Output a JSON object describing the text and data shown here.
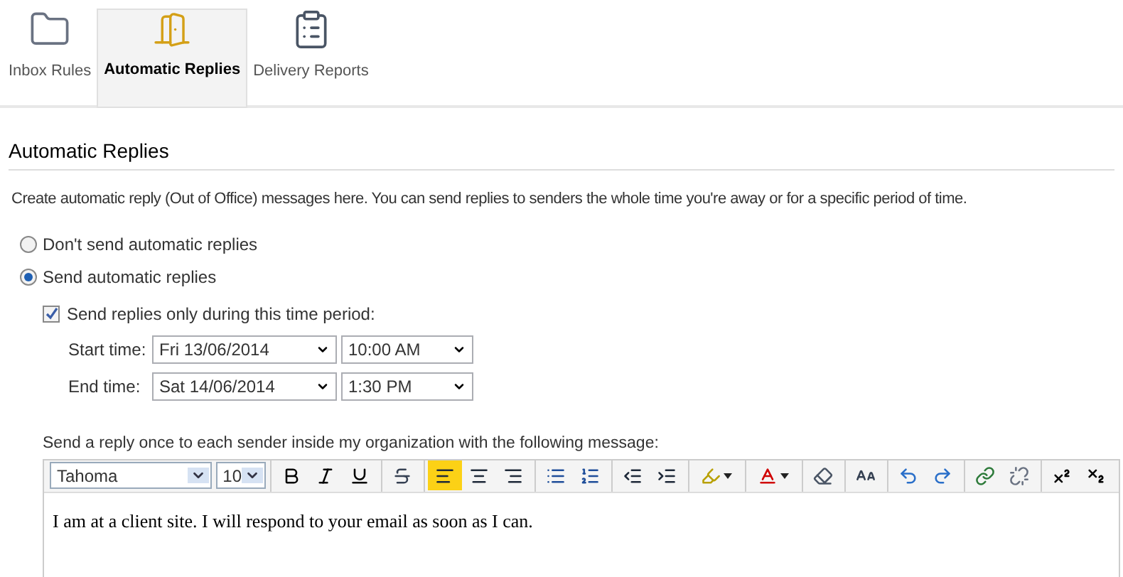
{
  "nav": [
    {
      "label": "Inbox Rules",
      "kind": "rules",
      "selected": false
    },
    {
      "label": "Automatic Replies",
      "kind": "replies",
      "selected": true
    },
    {
      "label": "Delivery Reports",
      "kind": "reports",
      "selected": false
    }
  ],
  "heading": "Automatic Replies",
  "description": "Create automatic reply (Out of Office) messages here. You can send replies to senders the whole time you're away or for a specific period of time.",
  "options": [
    {
      "label": "Don't send automatic replies",
      "selected": false
    },
    {
      "label": "Send automatic replies",
      "selected": true
    }
  ],
  "period": {
    "label": "Send replies only during this time period:",
    "checked": true
  },
  "times": [
    {
      "label": "Start time:",
      "date": "Fri 13/06/2014",
      "time": "10:00 AM"
    },
    {
      "label": "End time:",
      "date": "Sat 14/06/2014",
      "time": "1:30 PM"
    }
  ],
  "message_label": "Send a reply once to each sender inside my organization with the following message:",
  "font": {
    "family": "Tahoma",
    "size": "10"
  },
  "toolbar": [
    [
      {
        "kind": "bold",
        "selected": false
      },
      {
        "kind": "italic",
        "selected": false
      },
      {
        "kind": "underline",
        "selected": false
      }
    ],
    [
      {
        "kind": "strike",
        "selected": false
      }
    ],
    [
      {
        "kind": "align-left",
        "selected": true
      },
      {
        "kind": "align-center",
        "selected": false
      },
      {
        "kind": "align-right",
        "selected": false
      }
    ],
    [
      {
        "kind": "bullets",
        "selected": false
      },
      {
        "kind": "numbering",
        "selected": false
      }
    ],
    [
      {
        "kind": "outdent",
        "selected": false
      },
      {
        "kind": "indent",
        "selected": false
      }
    ],
    [
      {
        "kind": "highlight",
        "selected": false
      }
    ],
    [
      {
        "kind": "font-color",
        "selected": false
      }
    ],
    [
      {
        "kind": "eraser",
        "selected": false
      }
    ],
    [
      {
        "kind": "text-size",
        "selected": false
      }
    ],
    [
      {
        "kind": "undo",
        "selected": false
      },
      {
        "kind": "redo",
        "selected": false
      }
    ],
    [
      {
        "kind": "link",
        "selected": false
      },
      {
        "kind": "unlink",
        "selected": false
      }
    ],
    [
      {
        "kind": "superscript",
        "selected": false
      },
      {
        "kind": "subscript",
        "selected": false
      }
    ]
  ],
  "message": "I am at a client site. I will respond to your email as soon as I can."
}
